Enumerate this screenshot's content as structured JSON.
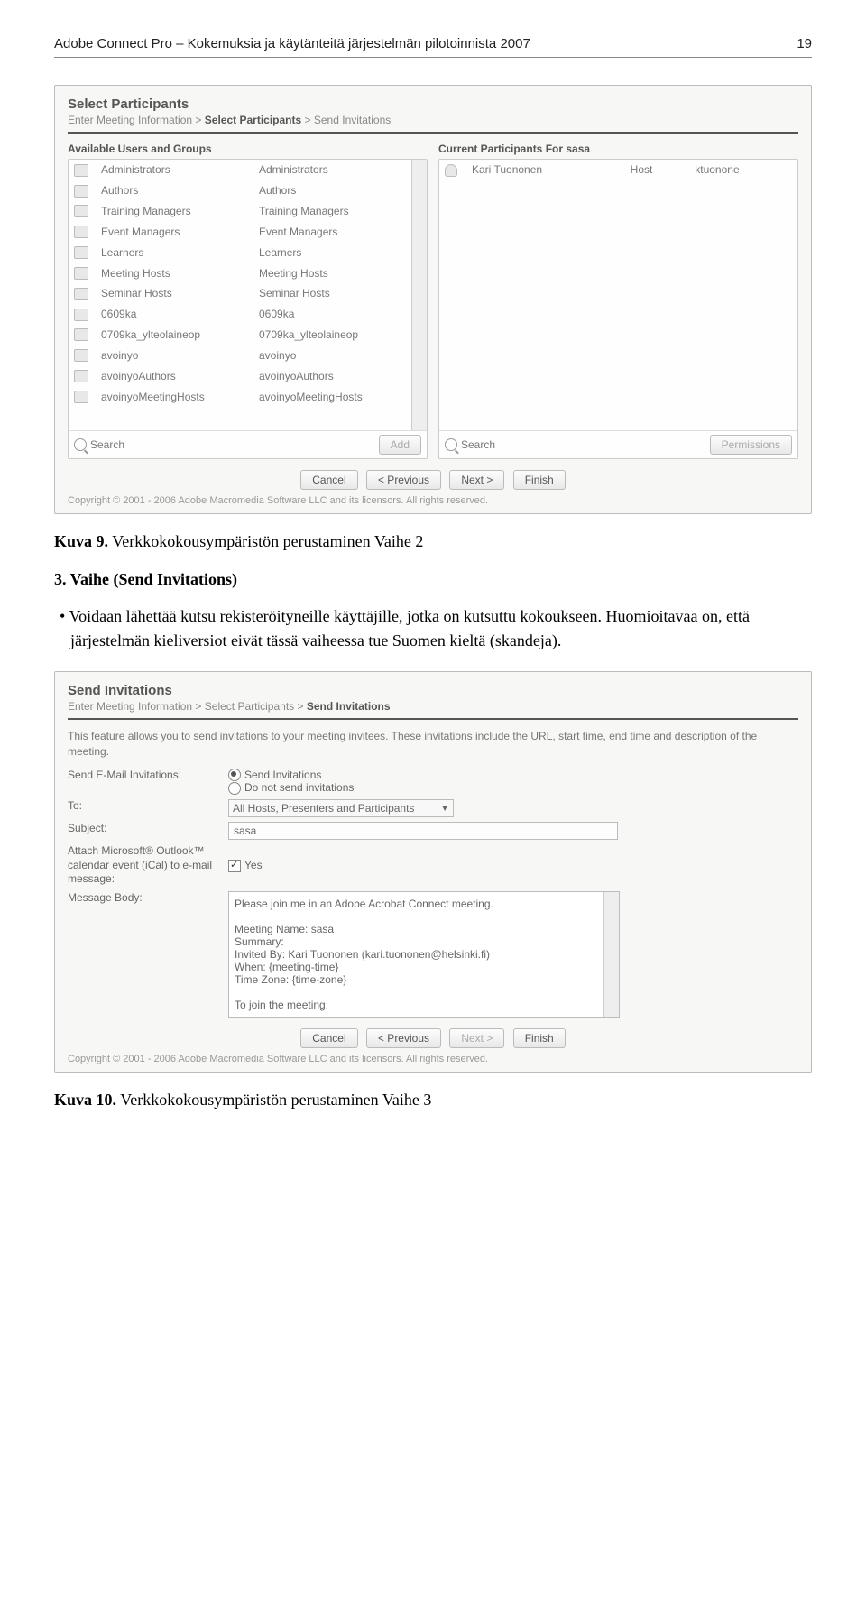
{
  "runningHead": {
    "title": "Adobe Connect Pro – Kokemuksia ja käytänteitä järjestelmän pilotoinnista 2007",
    "page": "19"
  },
  "caption1": {
    "label": "Kuva 9.",
    "text": "Verkkokokousympäristön perustaminen Vaihe 2"
  },
  "step3": {
    "title": "3. Vaihe (Send Invitations)",
    "bullet": "Voidaan lähettää kutsu rekisteröityneille käyttäjille, jotka on kutsuttu kokoukseen. Huomioitavaa on, että järjestelmän kieliversiot eivät tässä vaiheessa tue Suomen kieltä (skandeja)."
  },
  "caption2": {
    "label": "Kuva 10.",
    "text": "Verkkokokousympäristön perustaminen Vaihe 3"
  },
  "shot1": {
    "title": "Select Participants",
    "bread": {
      "a": "Enter Meeting Information",
      "b": "Select Participants",
      "c": "Send Invitations",
      "sep": ">"
    },
    "leftTitle": "Available Users and Groups",
    "rightTitle": "Current Participants For sasa",
    "groups": [
      {
        "n": "Administrators",
        "d": "Administrators"
      },
      {
        "n": "Authors",
        "d": "Authors"
      },
      {
        "n": "Training Managers",
        "d": "Training Managers"
      },
      {
        "n": "Event Managers",
        "d": "Event Managers"
      },
      {
        "n": "Learners",
        "d": "Learners"
      },
      {
        "n": "Meeting Hosts",
        "d": "Meeting Hosts"
      },
      {
        "n": "Seminar Hosts",
        "d": "Seminar Hosts"
      },
      {
        "n": "0609ka",
        "d": "0609ka"
      },
      {
        "n": "0709ka_ylteolaineop",
        "d": "0709ka_ylteolaineop"
      },
      {
        "n": "avoinyo",
        "d": "avoinyo"
      },
      {
        "n": "avoinyoAuthors",
        "d": "avoinyoAuthors"
      },
      {
        "n": "avoinyoMeetingHosts",
        "d": "avoinyoMeetingHosts"
      }
    ],
    "participants": [
      {
        "n": "Kari Tuononen",
        "r": "Host",
        "u": "ktuonone"
      }
    ],
    "search": "Search",
    "addBtn": "Add",
    "permBtn": "Permissions",
    "wiz": {
      "cancel": "Cancel",
      "prev": "< Previous",
      "next": "Next >",
      "finish": "Finish"
    },
    "copyright": "Copyright © 2001 - 2006 Adobe Macromedia Software LLC and its licensors. All rights reserved."
  },
  "shot2": {
    "title": "Send Invitations",
    "bread": {
      "a": "Enter Meeting Information",
      "b": "Select Participants",
      "c": "Send Invitations",
      "sep": ">"
    },
    "intro": "This feature allows you to send invitations to your meeting invitees. These invitations include the URL, start time, end time and description of the meeting.",
    "labels": {
      "sendEmail": "Send E-Mail Invitations:",
      "to": "To:",
      "subject": "Subject:",
      "attach": "Attach Microsoft® Outlook™ calendar event (iCal) to e-mail message:",
      "body": "Message Body:"
    },
    "radios": {
      "send": "Send Invitations",
      "dont": "Do not send invitations"
    },
    "toValue": "All Hosts, Presenters and Participants",
    "subjectValue": "sasa",
    "attachYes": "Yes",
    "bodyLines": [
      "Please join me in an Adobe Acrobat Connect meeting.",
      "",
      "Meeting Name:  sasa",
      "Summary:",
      "Invited By: Kari Tuononen (kari.tuononen@helsinki.fi)",
      "When:  {meeting-time}",
      "Time Zone:  {time-zone}",
      "",
      "To join the meeting:"
    ],
    "wiz": {
      "cancel": "Cancel",
      "prev": "< Previous",
      "next": "Next >",
      "finish": "Finish"
    },
    "copyright": "Copyright © 2001 - 2006 Adobe Macromedia Software LLC and its licensors. All rights reserved."
  }
}
